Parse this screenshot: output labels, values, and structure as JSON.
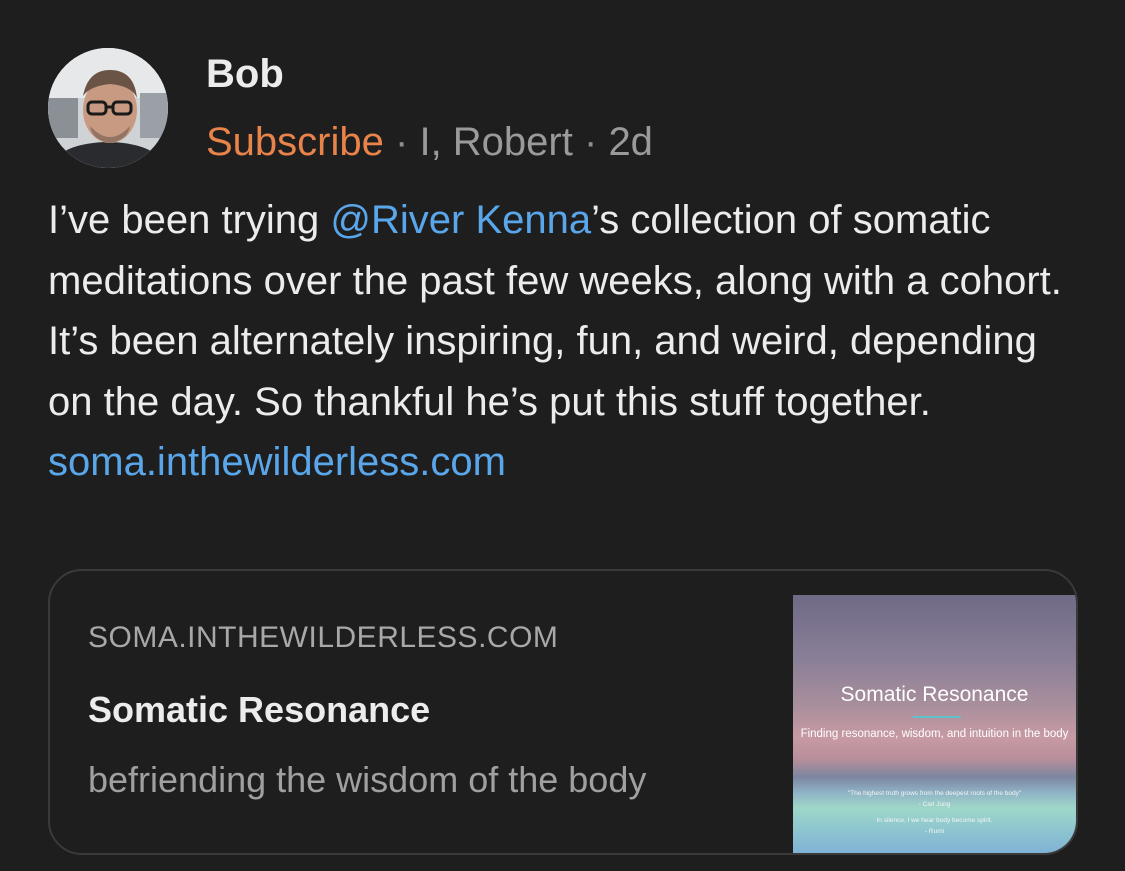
{
  "post": {
    "author": "Bob",
    "meta": {
      "subscribe_label": "Subscribe",
      "separator": "·",
      "publication": "I, Robert",
      "age": "2d"
    },
    "text_before_mention": "I’ve been trying ",
    "mention": "@River Kenna",
    "text_after_mention": "’s collection of somatic meditations over the past few weeks, along with a cohort. It’s been alternately inspiring, fun, and weird, depending on the day. So thankful he’s put this stuff together.",
    "link": "soma.inthewilderless.com"
  },
  "card": {
    "domain": "SOMA.INTHEWILDERLESS.COM",
    "title": "Somatic Resonance",
    "description": "befriending the wisdom of the body",
    "thumbnail": {
      "title": "Somatic Resonance",
      "subtitle": "Finding resonance, wisdom, and intuition in the body",
      "quote_1": "\"The highest truth grows from the deepest roots of the body\"",
      "quote_1_author": "- Carl Jung",
      "quote_2": "In silence, I we hear body become spirit.",
      "quote_2_author": "- Rumi"
    }
  },
  "colors": {
    "background": "#1e1e1e",
    "subscribe": "#e8834a",
    "link": "#5aa6ea",
    "muted": "#9a9a9a"
  },
  "icons": {
    "avatar": "profile-photo"
  }
}
